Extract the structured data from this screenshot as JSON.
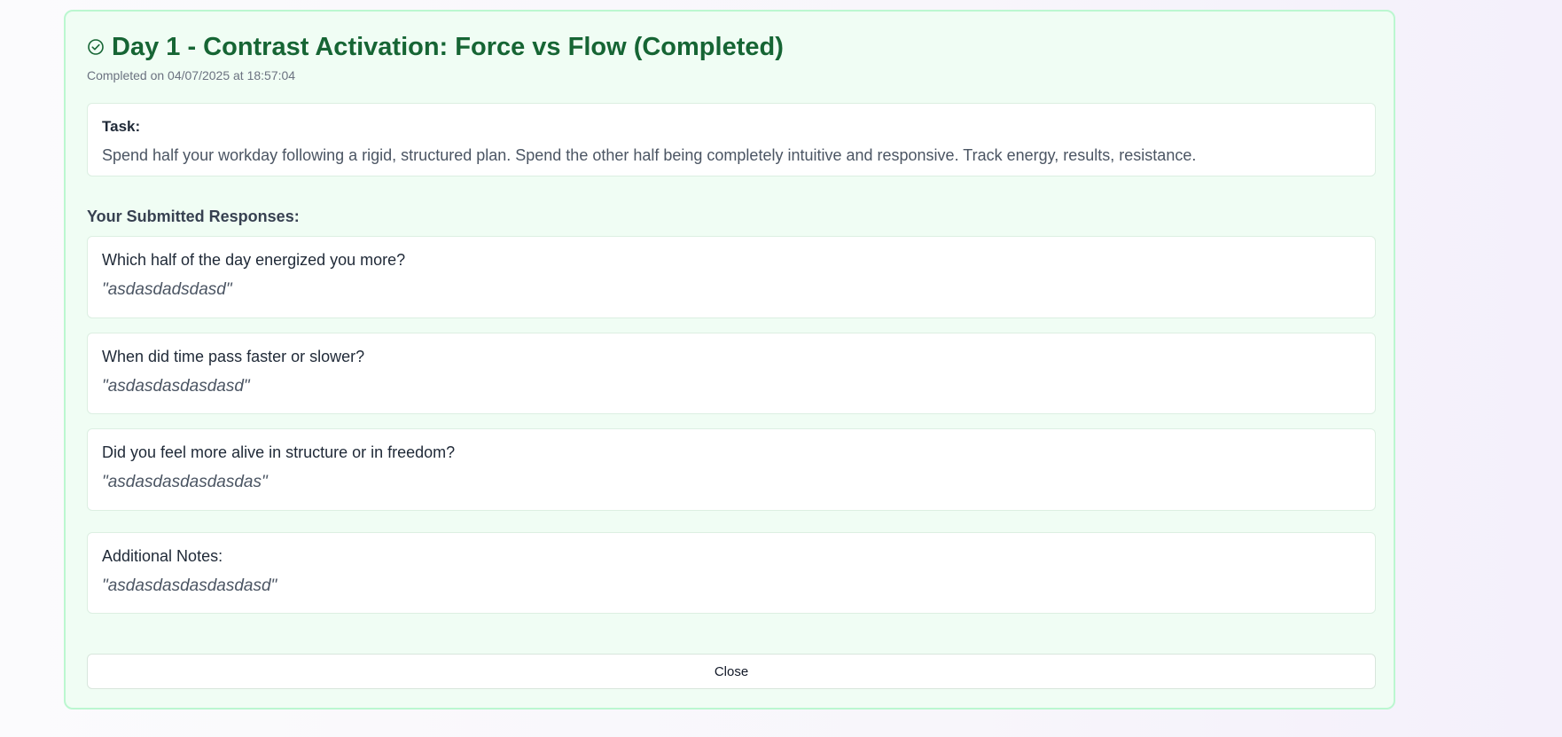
{
  "header": {
    "title": "Day 1 - Contrast Activation: Force vs Flow (Completed)",
    "completed_text": "Completed on 04/07/2025 at 18:57:04",
    "icon": "check-circle-icon",
    "title_color": "#166534"
  },
  "task": {
    "label": "Task:",
    "text": "Spend half your workday following a rigid, structured plan. Spend the other half being completely intuitive and responsive. Track energy, results, resistance."
  },
  "responses": {
    "heading": "Your Submitted Responses:",
    "items": [
      {
        "question": "Which half of the day energized you more?",
        "answer": "\"asdasdadsdasd\""
      },
      {
        "question": "When did time pass faster or slower?",
        "answer": "\"asdasdasdasdasd\""
      },
      {
        "question": "Did you feel more alive in structure or in freedom?",
        "answer": "\"asdasdasdasdasdas\""
      }
    ]
  },
  "notes": {
    "label": "Additional Notes:",
    "text": "\"asdasdasdasdasdasd\""
  },
  "footer": {
    "close_label": "Close"
  },
  "colors": {
    "card_background": "#f0fdf4",
    "card_border": "#bbf7d0",
    "accent": "#166534"
  }
}
